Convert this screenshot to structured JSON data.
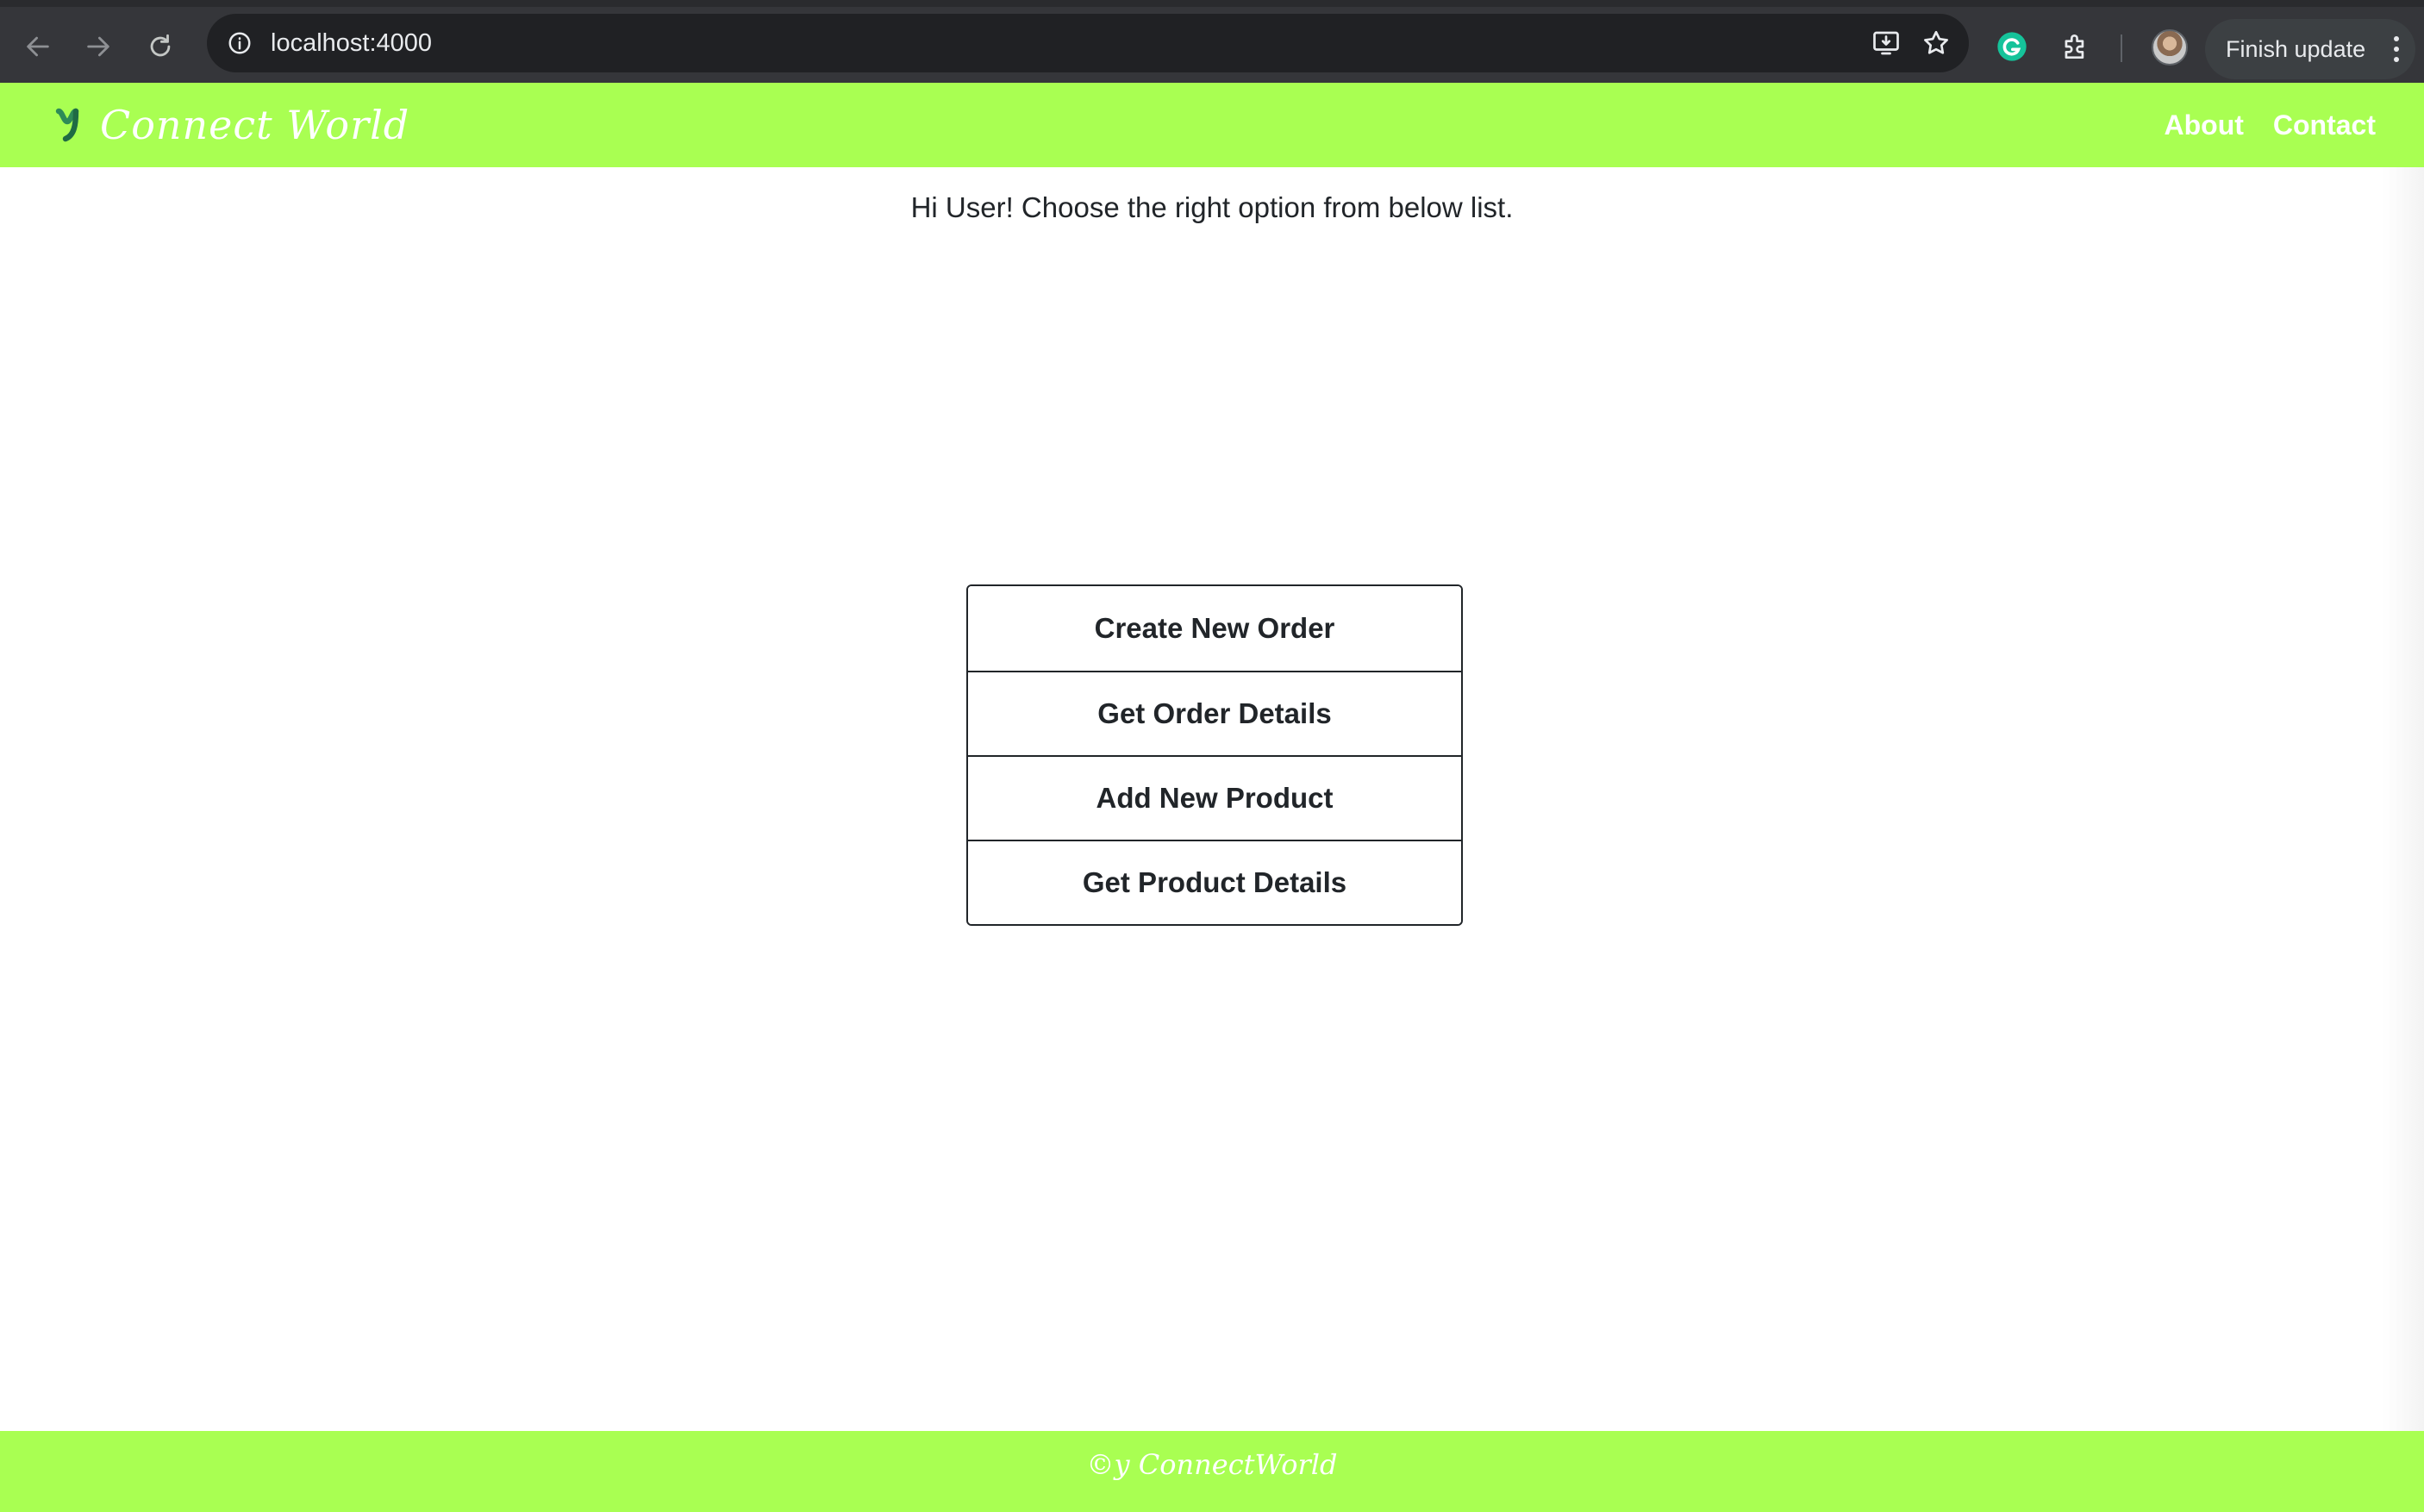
{
  "browser": {
    "url": "localhost:4000",
    "finish_update_label": "Finish update",
    "icons": {
      "back": "arrow-left-icon",
      "forward": "arrow-right-icon",
      "reload": "reload-icon",
      "site_info": "info-icon",
      "install": "install-app-icon",
      "bookmark": "star-icon",
      "grammarly": "grammarly-icon",
      "extensions": "puzzle-icon",
      "profile": "avatar",
      "menu": "kebab-menu-icon"
    }
  },
  "header": {
    "brand_name": "Connect World",
    "nav": [
      {
        "label": "About"
      },
      {
        "label": "Contact"
      }
    ],
    "background_color": "#a9ff52"
  },
  "main": {
    "greeting": "Hi User! Choose the right option from below list.",
    "options": [
      {
        "label": "Create New Order"
      },
      {
        "label": "Get Order Details"
      },
      {
        "label": "Add New Product"
      },
      {
        "label": "Get Product Details"
      }
    ]
  },
  "footer": {
    "text": "©y ConnectWorld"
  }
}
